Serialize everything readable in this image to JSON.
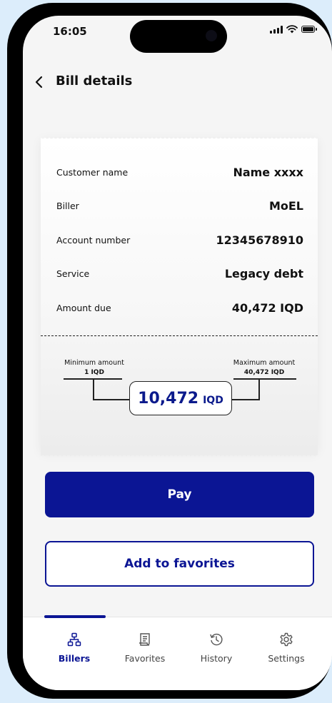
{
  "status_bar": {
    "time": "16:05"
  },
  "header": {
    "title": "Bill details"
  },
  "bill": {
    "rows": [
      {
        "label": "Customer name",
        "value": "Name xxxx"
      },
      {
        "label": "Biller",
        "value": "MoEL"
      },
      {
        "label": "Account number",
        "value": "12345678910"
      },
      {
        "label": "Service",
        "value": "Legacy debt"
      },
      {
        "label": "Amount due",
        "value": "40,472 IQD"
      }
    ],
    "minimum_label": "Minimum amount",
    "minimum_value": "1 IQD",
    "maximum_label": "Maximum amount",
    "maximum_value": "40,472 IQD",
    "amount": "10,472",
    "currency": "IQD"
  },
  "actions": {
    "pay_label": "Pay",
    "favorites_label": "Add to favorites"
  },
  "tabbar": {
    "tabs": [
      {
        "label": "Billers",
        "icon": "hierarchy-icon",
        "active": true
      },
      {
        "label": "Favorites",
        "icon": "receipt-icon",
        "active": false
      },
      {
        "label": "History",
        "icon": "history-icon",
        "active": false
      },
      {
        "label": "Settings",
        "icon": "gear-icon",
        "active": false
      }
    ]
  },
  "colors": {
    "primary": "#0b1594",
    "background": "#dcedfb"
  }
}
